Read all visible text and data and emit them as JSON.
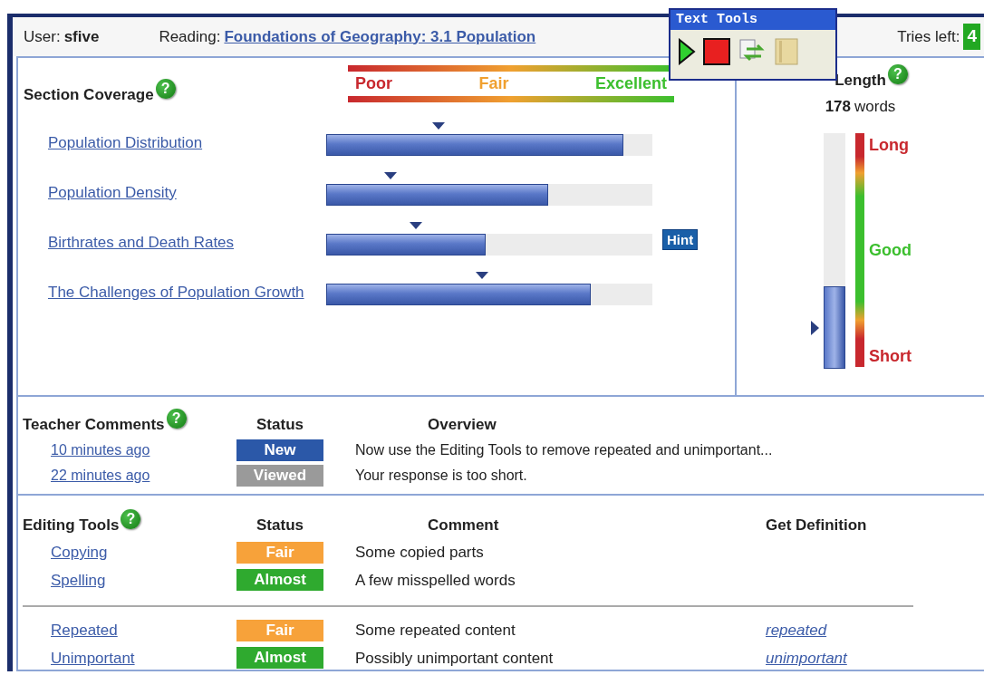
{
  "header": {
    "user_label": "User:",
    "user": "sfive",
    "reading_label": "Reading:",
    "reading": "Foundations of Geography: 3.1 Population",
    "tries_label": "Tries left:",
    "tries": "4"
  },
  "text_tools": {
    "title": "Text Tools"
  },
  "coverage": {
    "title": "Section Coverage",
    "help": "?",
    "scale": [
      {
        "label": "Poor",
        "color": "#c8282e"
      },
      {
        "label": "Fair",
        "color": "#f0a030"
      },
      {
        "label": "Excellent",
        "color": "#3cbf2e"
      }
    ],
    "sections": [
      {
        "label": "Population Distribution",
        "level": 0.91,
        "target": {
          "level": 0.345
        }
      },
      {
        "label": "Population Density",
        "level": 0.68,
        "target": {
          "level": 0.198
        }
      },
      {
        "label": "Birthrates and Death Rates",
        "level": 0.49,
        "target": {
          "level": 0.275
        },
        "hint": "Hint"
      },
      {
        "label": "The Challenges of Population Growth",
        "level": 0.81,
        "target": {
          "level": 0.478
        }
      }
    ]
  },
  "length": {
    "title": "Length",
    "help": "?",
    "count": "178",
    "unit": "words",
    "level": 0.35,
    "target": {
      "level": 0.17
    },
    "scale": [
      {
        "label": "Long",
        "color": "#c8282e"
      },
      {
        "label": "Good",
        "color": "#3cbf2e"
      },
      {
        "label": "Short",
        "color": "#c8282e"
      }
    ]
  },
  "teacher_comments": {
    "title": "Teacher Comments",
    "help": "?",
    "columns": [
      "Status",
      "Overview"
    ],
    "rows": [
      {
        "time": "10 minutes ago",
        "status": "New",
        "color": "#2b58a8",
        "overview": "Now use the Editing Tools to remove repeated and unimportant..."
      },
      {
        "time": "22 minutes ago",
        "status": "Viewed",
        "color": "#9a9a9a",
        "overview": "Your response is too short."
      }
    ]
  },
  "editing_tools": {
    "title": "Editing Tools",
    "help": "?",
    "columns": [
      "Status",
      "Comment",
      "Get Definition"
    ],
    "groups": [
      [
        {
          "tool": "Copying",
          "status": "Fair",
          "color": "#f7a23a",
          "comment": "Some copied parts"
        },
        {
          "tool": "Spelling",
          "status": "Almost",
          "color": "#2faa2f",
          "comment": "A few misspelled words"
        }
      ],
      [
        {
          "tool": "Repeated",
          "status": "Fair",
          "color": "#f7a23a",
          "comment": "Some repeated content",
          "definition": "repeated"
        },
        {
          "tool": "Unimportant",
          "status": "Almost",
          "color": "#2faa2f",
          "comment": "Possibly unimportant content",
          "definition": "unimportant"
        }
      ]
    ]
  }
}
